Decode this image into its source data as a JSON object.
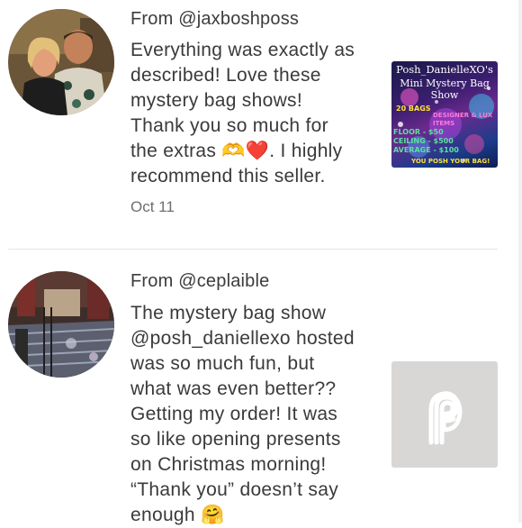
{
  "reviews": [
    {
      "from": "From @jaxboshposs",
      "lines": [
        "Everything was exactly as",
        "described! Love these",
        "mystery bag shows!",
        "Thank you so much for",
        "the extras 🫶❤️. I highly",
        "recommend this seller."
      ],
      "date": "Oct 11",
      "thumbnail": {
        "title": "Posh_DanielleXO's",
        "subtitle": "Mini Mystery Bag Show",
        "bags": "20 BAGS",
        "designer": "DESIGNER & LUX ITEMS",
        "floor": "FLOOR - $50",
        "ceiling": "CEILING - $500",
        "average": "AVERAGE - $100",
        "footer": "YOU POSH YOUR BAG!"
      }
    },
    {
      "from": "From @ceplaible",
      "lines": [
        "The mystery bag show",
        "@posh_daniellexo hosted",
        "was so much fun, but",
        "what was even better??",
        "Getting my order! It was",
        "so like opening presents",
        "on Christmas morning!",
        "“Thank you” doesn’t say",
        "enough 🤗"
      ],
      "thumbnail_icon": "poshmark-logo-icon"
    }
  ],
  "colors": {
    "placeholder_bg": "#d8d7d6",
    "divider": "#e6e6e6",
    "thumbnail_green": "#5ce0a0",
    "thumbnail_yellow": "#ffe23a"
  }
}
